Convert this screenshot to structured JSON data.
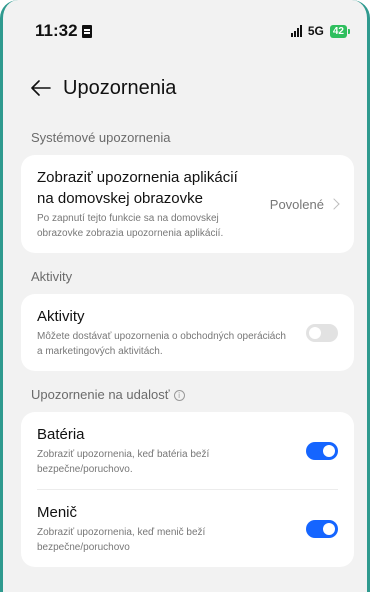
{
  "status_bar": {
    "time": "11:32",
    "network": "5G",
    "battery": "42"
  },
  "header": {
    "title": "Upozornenia"
  },
  "sections": {
    "system": {
      "label": "Systémové upozornenia",
      "item": {
        "title": "Zobraziť upozornenia aplikácií na domovskej obrazovke",
        "desc": "Po zapnutí tejto funkcie sa na domovskej obrazovke zobrazia upozornenia aplikácií.",
        "value": "Povolené"
      }
    },
    "activities": {
      "label": "Aktivity",
      "item": {
        "title": "Aktivity",
        "desc": "Môžete dostávať upozornenia o obchodných operáciách a marketingových aktivitách.",
        "enabled": false
      }
    },
    "events": {
      "label": "Upozornenie na udalosť",
      "items": [
        {
          "title": "Batéria",
          "desc": "Zobraziť upozornenia, keď batéria beží bezpečne/poruchovo.",
          "enabled": true
        },
        {
          "title": "Menič",
          "desc": "Zobraziť upozornenia, keď menič beží bezpečne/poruchovo",
          "enabled": true
        }
      ]
    }
  },
  "colors": {
    "accent": "#1565ff",
    "frame": "#2f9a8f",
    "battery": "#2fbf5e"
  }
}
